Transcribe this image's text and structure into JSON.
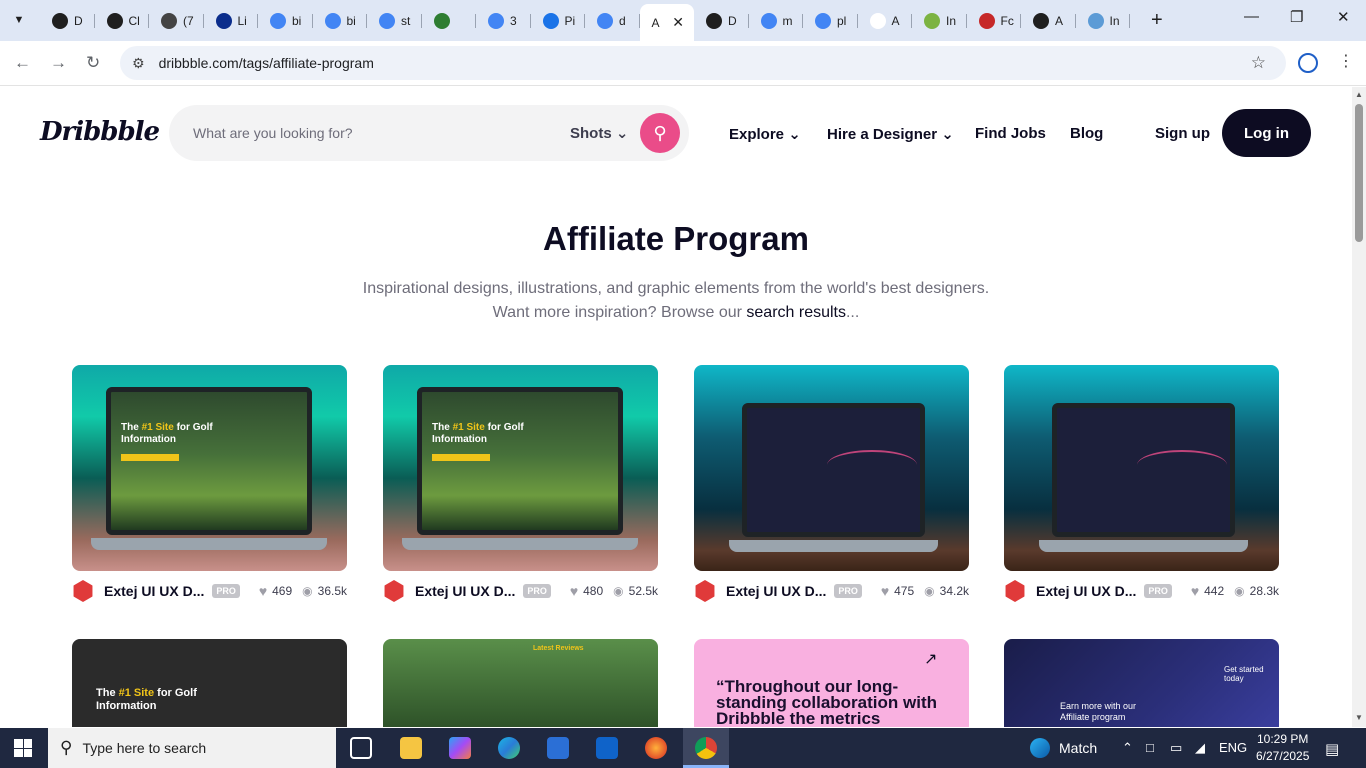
{
  "browser": {
    "tabs": [
      {
        "label": "D",
        "favicon": "openai-icon",
        "color": "#1f1f1f"
      },
      {
        "label": "Cl",
        "favicon": "openai-icon",
        "color": "#1f1f1f"
      },
      {
        "label": "(7",
        "favicon": "chat-icon",
        "color": "#444444"
      },
      {
        "label": "Li",
        "favicon": "ttp-icon",
        "color": "#0b2d8c"
      },
      {
        "label": "bi",
        "favicon": "google-icon",
        "color": "#4285f4"
      },
      {
        "label": "bi",
        "favicon": "google-icon",
        "color": "#4285f4"
      },
      {
        "label": "st",
        "favicon": "google-icon",
        "color": "#4285f4"
      },
      {
        "label": "",
        "favicon": "extension-icon",
        "color": "#2e7d32"
      },
      {
        "label": "3",
        "favicon": "google-icon",
        "color": "#4285f4"
      },
      {
        "label": "Pi",
        "favicon": "xf-icon",
        "color": "#1a73e8"
      },
      {
        "label": "d",
        "favicon": "google-icon",
        "color": "#4285f4"
      },
      {
        "label": "A",
        "favicon": "",
        "color": "#ffffff",
        "active": true
      },
      {
        "label": "D",
        "favicon": "openai-icon",
        "color": "#1f1f1f"
      },
      {
        "label": "m",
        "favicon": "google-icon",
        "color": "#4285f4"
      },
      {
        "label": "pl",
        "favicon": "google-icon",
        "color": "#4285f4"
      },
      {
        "label": "A",
        "favicon": "ad-icon",
        "color": "#ffffff"
      },
      {
        "label": "In",
        "favicon": "x-circle-icon",
        "color": "#7cb342"
      },
      {
        "label": "Fc",
        "favicon": "fb-icon",
        "color": "#c62828"
      },
      {
        "label": "A",
        "favicon": "car-icon",
        "color": "#1f1f1f"
      },
      {
        "label": "In",
        "favicon": "pen-icon",
        "color": "#5c9bd6"
      }
    ],
    "url": "dribbble.com/tags/affiliate-program"
  },
  "site": {
    "logo": "Dribbble",
    "search_placeholder": "What are you looking for?",
    "search_scope": "Shots",
    "nav": {
      "explore": "Explore",
      "hire": "Hire a Designer",
      "jobs": "Find Jobs",
      "blog": "Blog",
      "signup": "Sign up",
      "login": "Log in"
    },
    "heading": "Affiliate Program",
    "subtitle_line1": "Inspirational designs, illustrations, and graphic elements from the world's best designers.",
    "subtitle_line2_prefix": "Want more inspiration? Browse our ",
    "subtitle_link": "search results",
    "subtitle_line2_suffix": "..."
  },
  "shots": [
    {
      "author": "Extej UI UX D...",
      "badge": "PRO",
      "likes": "469",
      "views": "36.5k",
      "style": "golf",
      "headline_a": "The ",
      "headline_hi": "#1 Site",
      "headline_b": " for Golf",
      "headline_c": "Information"
    },
    {
      "author": "Extej UI UX D...",
      "badge": "PRO",
      "likes": "480",
      "views": "52.5k",
      "style": "golf",
      "headline_a": "The ",
      "headline_hi": "#1 Site",
      "headline_b": " for Golf",
      "headline_c": "Information"
    },
    {
      "author": "Extej UI UX D...",
      "badge": "PRO",
      "likes": "475",
      "views": "34.2k",
      "style": "dash"
    },
    {
      "author": "Extej UI UX D...",
      "badge": "PRO",
      "likes": "442",
      "views": "28.3k",
      "style": "dash"
    }
  ],
  "row2": {
    "card1_headline_a": "The ",
    "card1_headline_hi": "#1 Site",
    "card1_headline_b": " for Golf",
    "card1_headline_c": "Information",
    "card2_label": "Latest Reviews",
    "card3_quote": "“Throughout our long-standing collaboration with Dribbble the metrics",
    "card4_text": "Earn more with our Affiliate program",
    "card4_side": "Get started today"
  },
  "taskbar": {
    "search_placeholder": "Type here to search",
    "weather": "Match",
    "lang": "ENG",
    "time": "10:29 PM",
    "date": "6/27/2025"
  },
  "colors": {
    "accent": "#ea4c89",
    "dark": "#0d0c22"
  }
}
